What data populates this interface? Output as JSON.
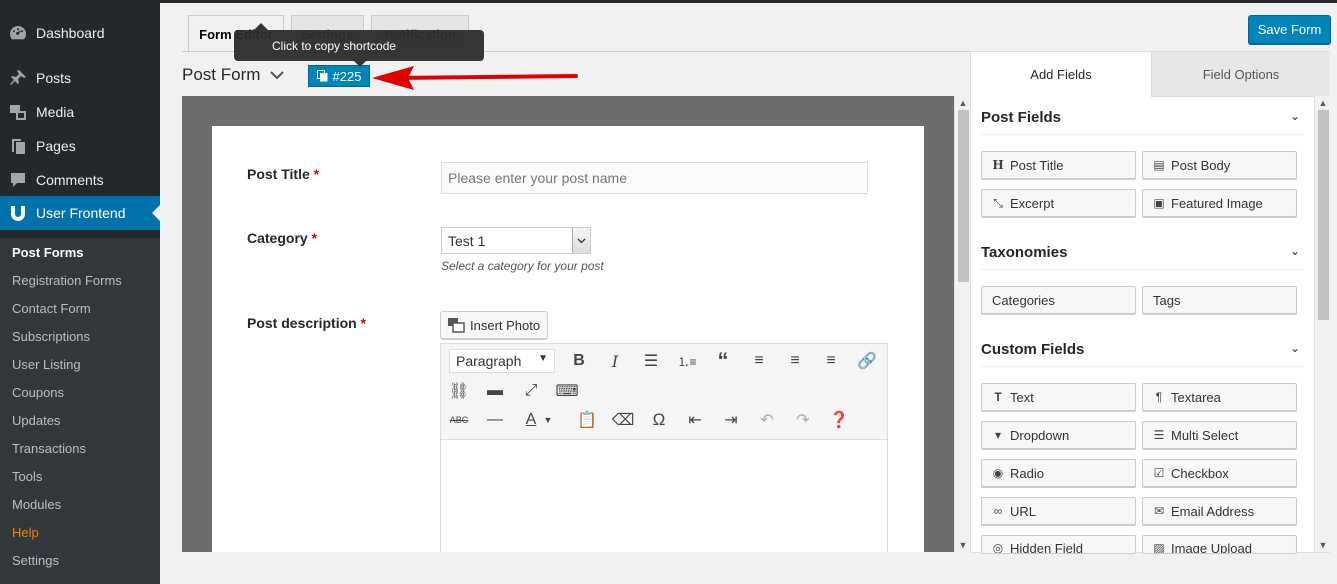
{
  "sidebar": {
    "menu": [
      {
        "label": "Dashboard",
        "icon": "dashboard-icon"
      },
      {
        "label": "Posts",
        "icon": "pin-icon"
      },
      {
        "label": "Media",
        "icon": "media-icon"
      },
      {
        "label": "Pages",
        "icon": "pages-icon"
      },
      {
        "label": "Comments",
        "icon": "comment-icon"
      },
      {
        "label": "User Frontend",
        "icon": "wpuf-icon"
      }
    ],
    "submenu": [
      "Post Forms",
      "Registration Forms",
      "Contact Form",
      "Subscriptions",
      "User Listing",
      "Coupons",
      "Updates",
      "Transactions",
      "Tools",
      "Modules",
      "Help",
      "Settings"
    ]
  },
  "tabs": {
    "form_editor": "Form Editor",
    "settings": "Settings",
    "notification": "Notification"
  },
  "toolbar": {
    "save_label": "Save Form"
  },
  "tooltip": "Click to copy shortcode",
  "form": {
    "title": "Post Form",
    "shortcode": "#225"
  },
  "fields": {
    "post_title": {
      "label": "Post Title",
      "required": "*",
      "placeholder": "Please enter your post name"
    },
    "category": {
      "label": "Category",
      "required": "*",
      "value": "Test 1",
      "help": "Select a category for your post"
    },
    "description": {
      "label": "Post description",
      "required": "*",
      "insert_photo": "Insert Photo",
      "format": "Paragraph"
    }
  },
  "panel": {
    "tabs": {
      "add_fields": "Add Fields",
      "field_options": "Field Options"
    },
    "sections": {
      "post_fields": {
        "title": "Post Fields",
        "buttons": [
          {
            "label": "Post Title",
            "icon": "heading-icon"
          },
          {
            "label": "Post Body",
            "icon": "file-icon"
          },
          {
            "label": "Excerpt",
            "icon": "compress-icon"
          },
          {
            "label": "Featured Image",
            "icon": "image-icon"
          }
        ]
      },
      "taxonomies": {
        "title": "Taxonomies",
        "buttons": [
          {
            "label": "Categories",
            "icon": ""
          },
          {
            "label": "Tags",
            "icon": ""
          }
        ]
      },
      "custom_fields": {
        "title": "Custom Fields",
        "buttons": [
          {
            "label": "Text",
            "icon": "text-icon"
          },
          {
            "label": "Textarea",
            "icon": "paragraph-icon"
          },
          {
            "label": "Dropdown",
            "icon": "dropdown-icon"
          },
          {
            "label": "Multi Select",
            "icon": "list-icon"
          },
          {
            "label": "Radio",
            "icon": "radio-icon"
          },
          {
            "label": "Checkbox",
            "icon": "checkbox-icon"
          },
          {
            "label": "URL",
            "icon": "link-icon"
          },
          {
            "label": "Email Address",
            "icon": "envelope-icon"
          },
          {
            "label": "Hidden Field",
            "icon": "eye-slash-icon"
          },
          {
            "label": "Image Upload",
            "icon": "file-image-icon"
          }
        ]
      }
    }
  },
  "colors": {
    "accent": "#0085ba",
    "sidebar": "#23282d",
    "active_menu": "#0073aa",
    "help": "#f18500",
    "arrow": "#e00000"
  }
}
